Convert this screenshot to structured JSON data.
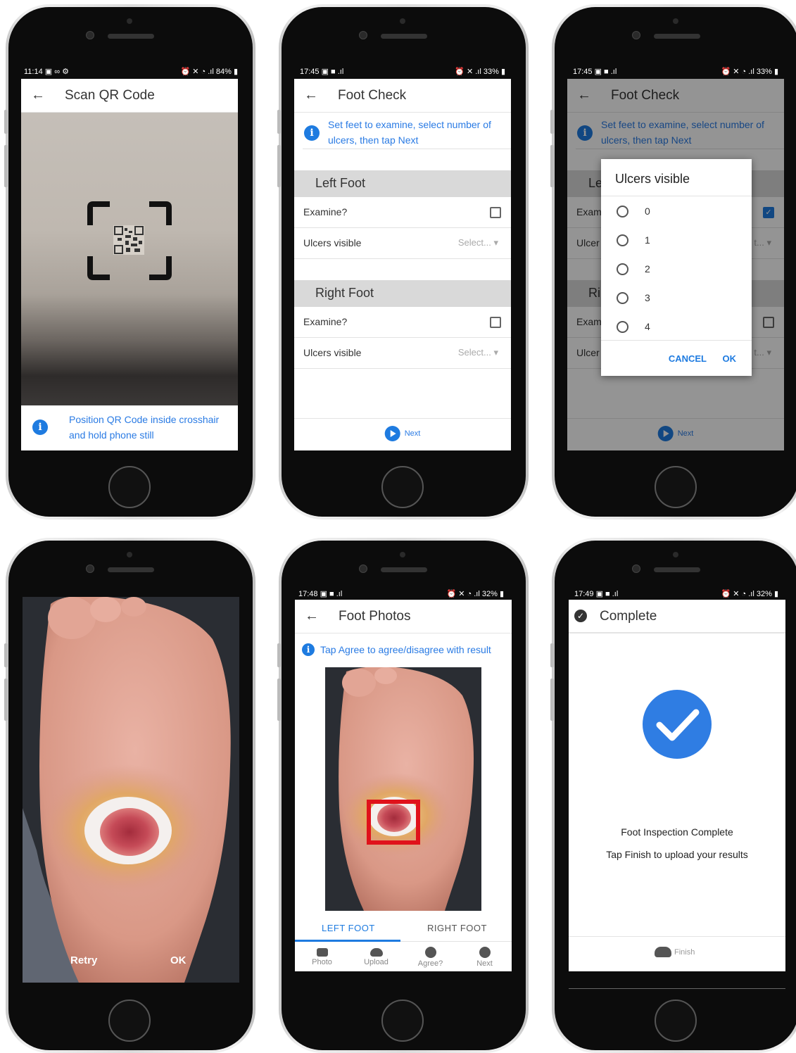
{
  "colors": {
    "accent": "#1e7be0",
    "highlight_box": "#e0121b"
  },
  "phone1": {
    "status": {
      "time": "11:14",
      "left_icons": "▣ ∞ ⚙",
      "right_icons": "⏰ ✕ ◔ .ıl",
      "battery": "84%"
    },
    "title": "Scan QR Code",
    "hint": "Position QR Code inside crosshair and hold phone still"
  },
  "phone2": {
    "status": {
      "time": "17:45",
      "left_icons": "▣ ■ .ıl",
      "right_icons": "⏰ ✕ .ıl",
      "battery": "33%"
    },
    "title": "Foot Check",
    "hint": "Set feet to examine, select number of ulcers, then tap Next",
    "left_section": "Left Foot",
    "right_section": "Right Foot",
    "examine_label": "Examine?",
    "ulcers_label": "Ulcers visible",
    "select_placeholder": "Select...",
    "next_label": "Next"
  },
  "phone3": {
    "status": {
      "time": "17:45",
      "left_icons": "▣ ■ .ıl",
      "right_icons": "⏰ ✕ ◔ .ıl",
      "battery": "33%"
    },
    "title": "Foot Check",
    "hint": "Set feet to examine, select number of ulcers, then tap Next",
    "behind": {
      "left_trunc": "Le",
      "right_trunc": "Ri",
      "exam_trunc": "Exam",
      "ulcer_trunc": "Ulcer",
      "sel_trunc": "t..."
    },
    "dialog": {
      "title": "Ulcers visible",
      "options": [
        "0",
        "1",
        "2",
        "3",
        "4"
      ],
      "cancel": "CANCEL",
      "ok": "OK"
    },
    "next_label": "Next"
  },
  "phone4": {
    "retry": "Retry",
    "ok": "OK"
  },
  "phone5": {
    "status": {
      "time": "17:48",
      "left_icons": "▣ ■ .ıl",
      "right_icons": "⏰ ✕ ◔ .ıl",
      "battery": "32%"
    },
    "title": "Foot Photos",
    "hint": "Tap Agree to agree/disagree with result",
    "tab_left": "LEFT FOOT",
    "tab_right": "RIGHT FOOT",
    "bottom": [
      "Photo",
      "Upload",
      "Agree?",
      "Next"
    ]
  },
  "phone6": {
    "status": {
      "time": "17:49",
      "left_icons": "▣ ■ .ıl",
      "right_icons": "⏰ ✕ ◔ .ıl",
      "battery": "32%"
    },
    "title": "Complete",
    "line1": "Foot Inspection Complete",
    "line2": "Tap Finish to upload your results",
    "finish": "Finish"
  }
}
